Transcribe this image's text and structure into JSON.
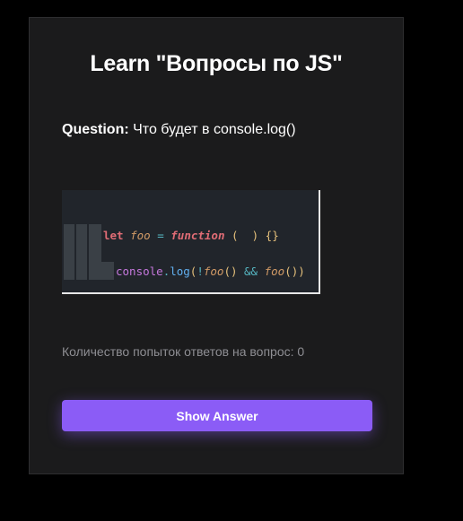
{
  "title": "Learn \"Вопросы по JS\"",
  "question": {
    "label": "Question:",
    "text": "Что будет в console.log()"
  },
  "code_snippet": {
    "line1": {
      "kw": "let",
      "var": "foo",
      "eq": "=",
      "fn": "function",
      "parens": "(  )",
      "braces": "{}"
    },
    "line2": {
      "obj": "console",
      "dot": ".",
      "method": "log",
      "open": "(",
      "not": "!",
      "call1": "foo",
      "call1_parens": "()",
      "and": "&&",
      "call2": "foo",
      "call2_parens": "()",
      "close": ")"
    }
  },
  "attempts_text": "Количество попыток ответов на вопрос: 0",
  "show_answer_label": "Show Answer",
  "colors": {
    "accent": "#8b5cf6",
    "card_bg": "#1b1b1c",
    "page_bg": "#000000"
  }
}
